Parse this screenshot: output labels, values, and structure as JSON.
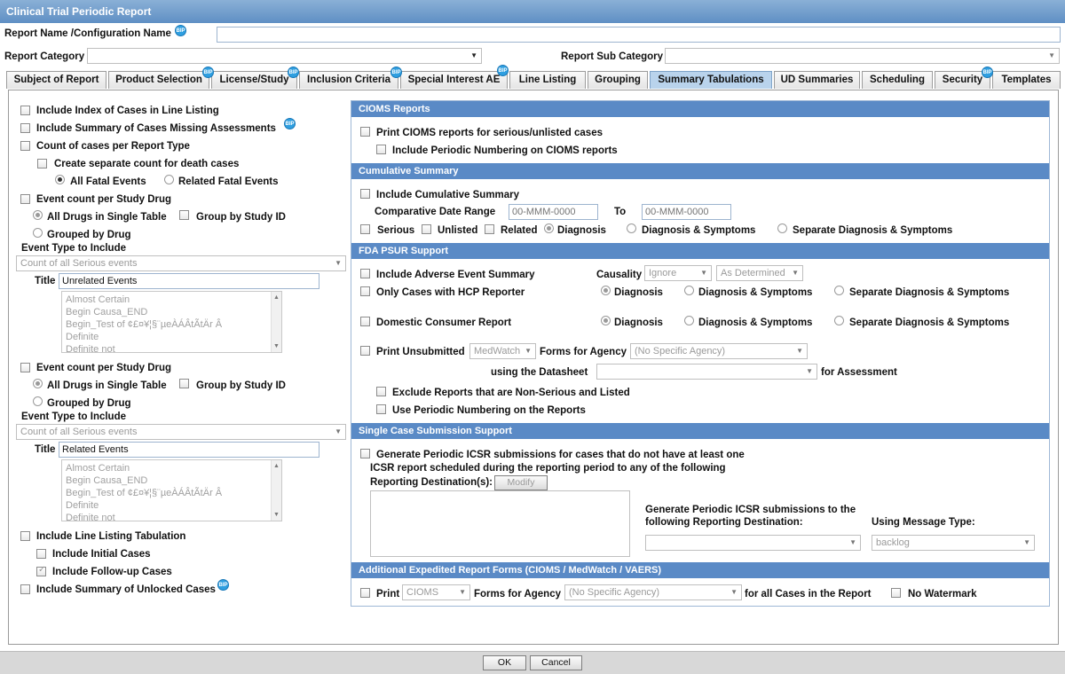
{
  "window": {
    "title": "Clinical Trial Periodic Report"
  },
  "header": {
    "report_name_label": "Report Name /Configuration Name",
    "report_name_value": "",
    "category_label": "Report Category",
    "category_value": "",
    "subcategory_label": "Report Sub Category",
    "subcategory_value": ""
  },
  "tabs": [
    {
      "label": "Subject of Report"
    },
    {
      "label": "Product Selection"
    },
    {
      "label": "License/Study"
    },
    {
      "label": "Inclusion Criteria"
    },
    {
      "label": "Special Interest AE"
    },
    {
      "label": "Line Listing"
    },
    {
      "label": "Grouping"
    },
    {
      "label": "Summary Tabulations",
      "active": true
    },
    {
      "label": "UD Summaries"
    },
    {
      "label": "Scheduling"
    },
    {
      "label": "Security"
    },
    {
      "label": "Templates"
    }
  ],
  "bip": "BIP",
  "left": {
    "include_index": "Include Index of Cases in Line Listing",
    "include_missing": "Include Summary of Cases Missing Assessments",
    "count_per_type": "Count of cases per Report Type",
    "separate_death": "Create separate count for death cases",
    "all_fatal": "All Fatal Events",
    "related_fatal": "Related Fatal Events",
    "ec1": {
      "label": "Event count per Study Drug",
      "all_drugs": "All Drugs in Single Table",
      "group_by_study": "Group by Study ID",
      "grouped_by_drug": "Grouped by Drug",
      "event_type": "Event Type to Include",
      "event_select": "Count of all Serious events",
      "title_label": "Title",
      "title_value": "Unrelated Events"
    },
    "ec2": {
      "label": "Event count per Study Drug",
      "all_drugs": "All Drugs in Single Table",
      "group_by_study": "Group by Study ID",
      "grouped_by_drug": "Grouped by Drug",
      "event_type": "Event Type to Include",
      "event_select": "Count of all Serious events",
      "title_label": "Title",
      "title_value": "Related Events"
    },
    "causality_list": [
      "Almost Certain",
      "Begin Causa_END",
      "Begin_Test of ¢£¤¥¦§¨µeÀÁÂtÃtÄr Â",
      "Definite",
      "Definite not"
    ],
    "include_ll_tab": "Include Line Listing Tabulation",
    "include_initial": "Include Initial Cases",
    "include_followup": "Include Follow-up Cases",
    "include_unlocked": "Include Summary of Unlocked Cases"
  },
  "cioms": {
    "header": "CIOMS Reports",
    "print_cioms": "Print CIOMS reports for serious/unlisted cases",
    "periodic_numbering": "Include Periodic Numbering on CIOMS reports"
  },
  "cumulative": {
    "header": "Cumulative Summary",
    "include": "Include Cumulative Summary",
    "comp_range": "Comparative Date Range",
    "from_ph": "00-MMM-0000",
    "to_label": "To",
    "to_ph": "00-MMM-0000",
    "serious": "Serious",
    "unlisted": "Unlisted",
    "related": "Related",
    "diagnosis": "Diagnosis",
    "diag_symp": "Diagnosis & Symptoms",
    "sep_diag_symp": "Separate Diagnosis & Symptoms"
  },
  "fda": {
    "header": "FDA PSUR Support",
    "include_ae": "Include Adverse Event Summary",
    "causality": "Causality",
    "causality_val": "Ignore",
    "as_determined": "As Determined",
    "hcp": "Only Cases with HCP Reporter",
    "domestic": "Domestic Consumer Report",
    "diagnosis": "Diagnosis",
    "diag_symp": "Diagnosis & Symptoms",
    "sep_diag_symp": "Separate Diagnosis & Symptoms",
    "print_unsub": "Print Unsubmitted",
    "medwatch": "MedWatch",
    "forms_for_agency": "Forms for Agency",
    "no_agency": "(No Specific Agency)",
    "using_ds": "using the Datasheet",
    "for_assessment": "for Assessment",
    "exclude_ns": "Exclude Reports that are Non-Serious and Listed",
    "use_periodic": "Use Periodic Numbering on the Reports"
  },
  "single": {
    "header": "Single Case Submission Support",
    "generate1": "Generate Periodic ICSR submissions for cases that do not have at least one",
    "generate2": "ICSR report scheduled during the reporting period to any of the following",
    "reporting_dest": "Reporting Destination(s):",
    "modify": "Modify",
    "gen_to1": "Generate Periodic ICSR submissions to the",
    "gen_to2": "following Reporting Destination:",
    "using_msg": "Using Message Type:",
    "msg_val": "backlog"
  },
  "expedited": {
    "header": "Additional Expedited Report Forms (CIOMS / MedWatch / VAERS)",
    "print": "Print",
    "cioms": "CIOMS",
    "forms_for_agency": "Forms for Agency",
    "no_agency": "(No Specific Agency)",
    "for_all": "for all Cases in the Report",
    "no_watermark": "No Watermark"
  },
  "footer": {
    "ok": "OK",
    "cancel": "Cancel"
  }
}
